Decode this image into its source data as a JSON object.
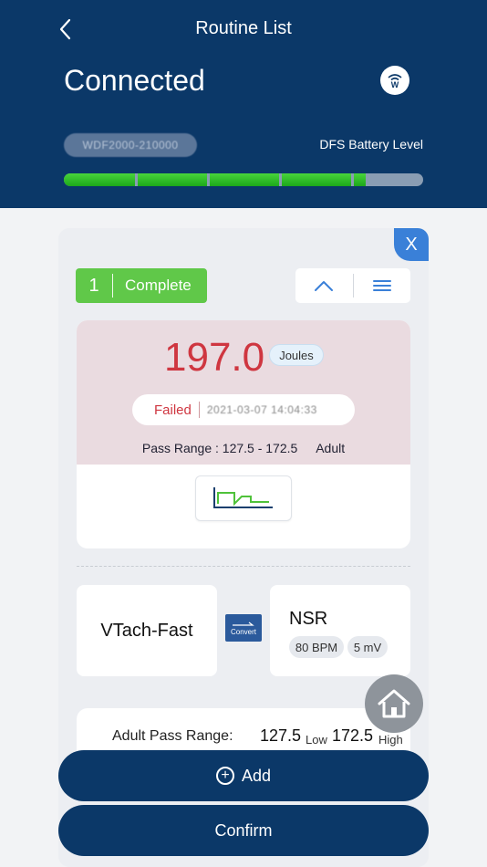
{
  "header": {
    "title": "Routine List",
    "status": "Connected",
    "device_serial": "WDF2000-210000",
    "battery_label": "DFS Battery Level",
    "battery_level_fraction": 0.84,
    "battery_segments": 5
  },
  "routine": {
    "close_label": "X",
    "index": "1",
    "status_label": "Complete",
    "energy_value": "197.0",
    "energy_unit": "Joules",
    "result": "Failed",
    "timestamp": "2021-03-07 14:04:33",
    "pass_range_text": "Pass Range : 127.5 - 172.5",
    "patient_type": "Adult",
    "waveform_icon": "waveform-icon"
  },
  "rhythm": {
    "from": "VTach-Fast",
    "convert_label": "Convert",
    "to": "NSR",
    "rate": "80 BPM",
    "amplitude": "5 mV"
  },
  "pass_range": {
    "label": "Adult Pass Range:",
    "low_value": "127.5",
    "low_label": "Low",
    "high_value": "172.5",
    "high_label": "High"
  },
  "actions": {
    "add_label": "Add",
    "confirm_label": "Confirm"
  },
  "colors": {
    "header_bg": "#0b3868",
    "complete_green": "#60c849",
    "failed_red": "#cf3640",
    "battery_green": "#2fbf26",
    "accent_blue": "#3a80d8"
  }
}
